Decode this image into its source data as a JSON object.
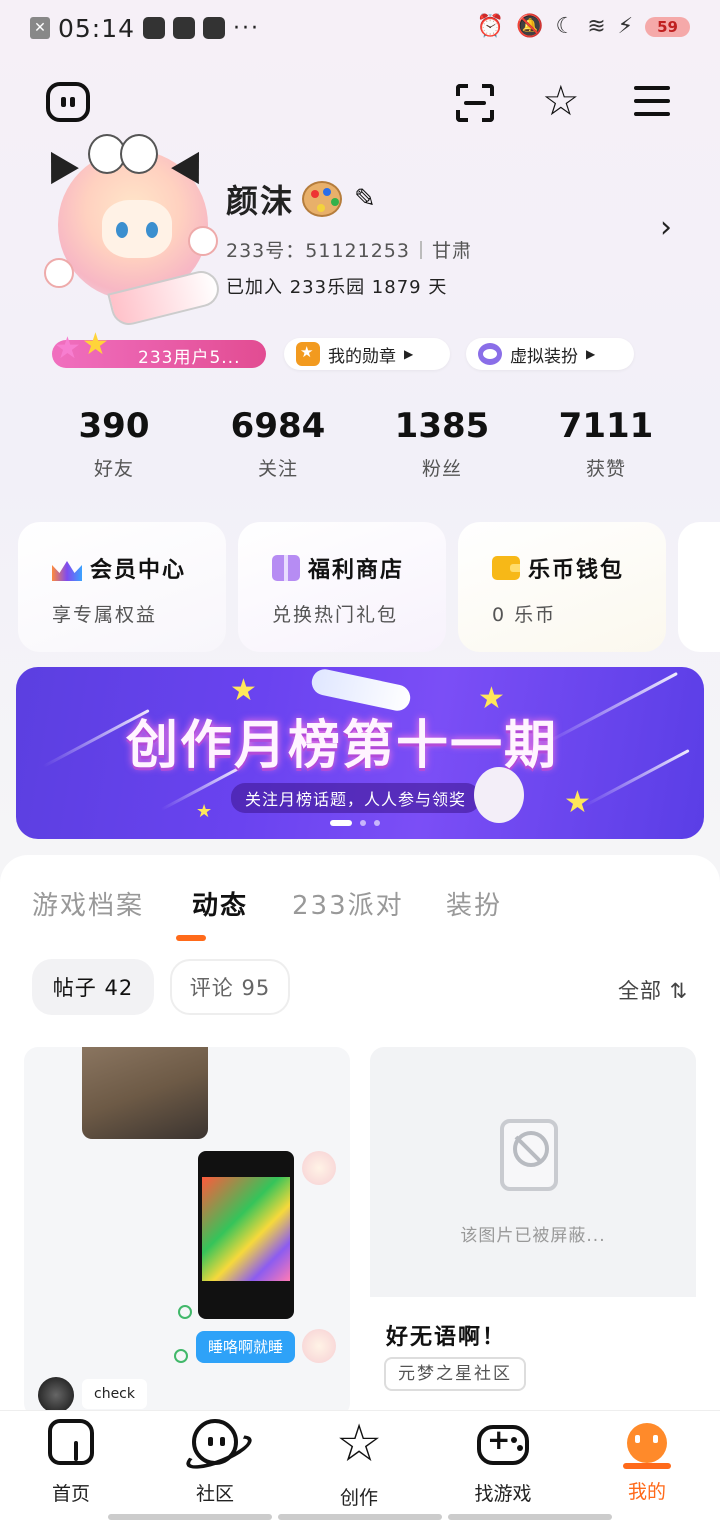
{
  "status_bar": {
    "time": "05:14",
    "dots": "···",
    "battery": "59"
  },
  "profile": {
    "name": "颜沫",
    "id_text": "233号：51121253",
    "region": "甘肃",
    "joined": "已加入 233乐园 1879 天"
  },
  "badges": {
    "level": "233用户5...",
    "medal": "我的勋章",
    "avatar_dress": "虚拟装扮"
  },
  "stats": [
    {
      "value": "390",
      "label": "好友"
    },
    {
      "value": "6984",
      "label": "关注"
    },
    {
      "value": "1385",
      "label": "粉丝"
    },
    {
      "value": "7111",
      "label": "获赞"
    }
  ],
  "cards": [
    {
      "title": "会员中心",
      "sub": "享专属权益"
    },
    {
      "title": "福利商店",
      "sub": "兑换热门礼包"
    },
    {
      "title": "乐币钱包",
      "sub": "0 乐币"
    }
  ],
  "banner": {
    "title": "创作月榜第十一期",
    "subtitle": "关注月榜话题，人人参与领奖"
  },
  "tabs": [
    "游戏档案",
    "动态",
    "233派对",
    "装扮"
  ],
  "chips": {
    "posts": "帖子 42",
    "comments": "评论 95",
    "filter": "全部 ⇅"
  },
  "posts": {
    "left": {
      "bubble": "睡咯啊就睡",
      "check": "check"
    },
    "right": {
      "blocked": "该图片已被屏蔽...",
      "title": "好无语啊！",
      "tag": "元梦之星社区"
    }
  },
  "nav": [
    {
      "label": "首页"
    },
    {
      "label": "社区"
    },
    {
      "label": "创作"
    },
    {
      "label": "找游戏"
    },
    {
      "label": "我的"
    }
  ],
  "colors": {
    "accent": "#ff6a1a",
    "banner": "#6a43f0",
    "level_badge": "#e24c92"
  }
}
